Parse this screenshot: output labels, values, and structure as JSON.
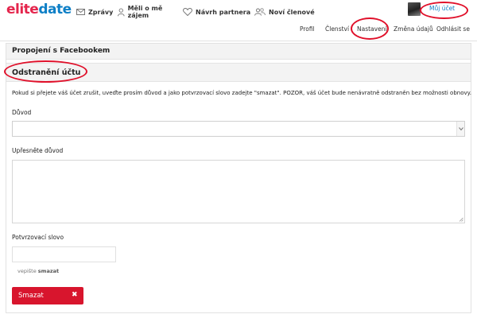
{
  "brand": {
    "name_part1": "elite",
    "name_part2": "date",
    "color_primary": "#e4254c",
    "color_secondary": "#0e7fc6"
  },
  "topnav": [
    {
      "label": "Zprávy",
      "icon": "envelope-icon"
    },
    {
      "label": "Měli o mě zájem",
      "icon": "person-icon"
    },
    {
      "label": "Návrh partnera",
      "icon": "heart-icon"
    },
    {
      "label": "Noví členové",
      "icon": "people-icon"
    }
  ],
  "account": {
    "label": "Můj účet"
  },
  "subnav": [
    {
      "label": "Profil"
    },
    {
      "label": "Členství"
    },
    {
      "label": "Nastavení"
    },
    {
      "label": "Změna údajů"
    },
    {
      "label": "Odhlásit se"
    }
  ],
  "sections": {
    "facebook": "Propojení s Facebookem",
    "delete": "Odstranění účtu"
  },
  "form": {
    "intro": "Pokud si přejete váš účet zrušit, uveďte prosím důvod a jako potvrzovací slovo zadejte \"smazat\". POZOR, váš účet bude nenávratně odstraněn bez možnosti obnovy.",
    "reason_label": "Důvod",
    "reason_value": "",
    "details_label": "Upřesněte důvod",
    "confirm_label": "Potvrzovací slovo",
    "confirm_value": "",
    "hint_text": "vepište",
    "hint_word": "smazat",
    "submit_label": "Smazat",
    "submit_icon": "✖",
    "submit_color": "#d8152d"
  },
  "annotation_color": "#e0102a"
}
